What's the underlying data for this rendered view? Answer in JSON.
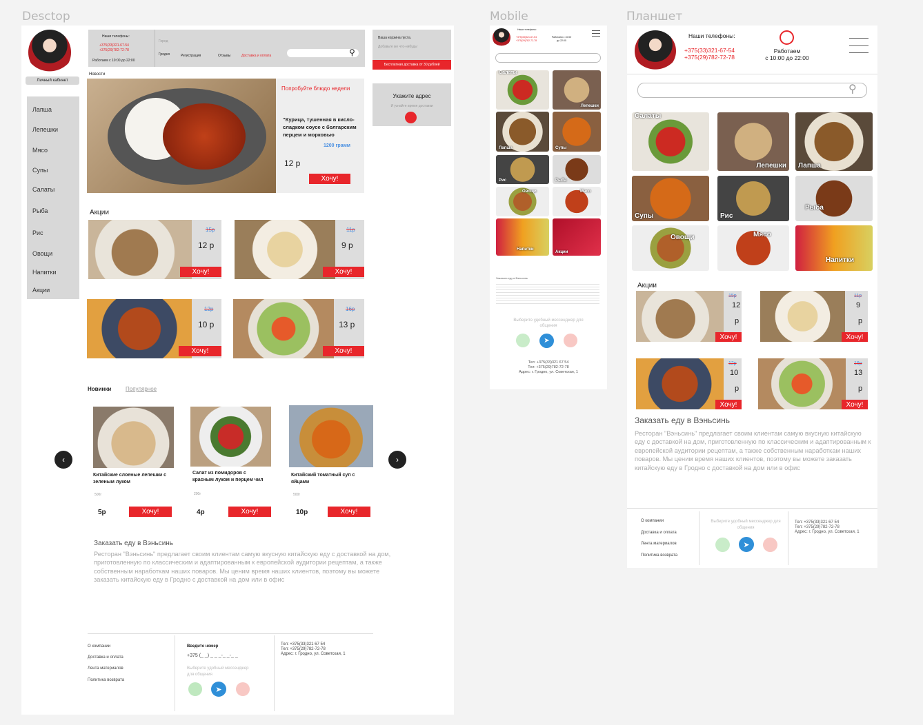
{
  "labels": {
    "desktop": "Desctop",
    "mobile": "Mobile",
    "tablet": "Планшет"
  },
  "desktop": {
    "header": {
      "phones_title": "Наши телефоны:",
      "phone1": "+375(33)321-67-54",
      "phone2": "+375(29)782-72-78",
      "hours": "Работаем с 10:00 до 22:00",
      "city_label": "Город",
      "city": "Гродно",
      "nav": [
        "Регистрация",
        "Отзывы",
        "Доставка и оплата"
      ],
      "cart_title": "Ваша корзина пуста.",
      "cart_sub": "Добавьте же что-нибудь!",
      "free_delivery": "Бесплатная доставка от 30 рублей"
    },
    "account": "Личный кабинет",
    "sidebar": [
      "Лапша",
      "Лепешки",
      "Мясо",
      "Супы",
      "Салаты",
      "Рыба",
      "Рис",
      "Овощи",
      "Напитки",
      "Акции"
    ],
    "news": "Новости",
    "hero": {
      "headline": "Попробуйте блюдо недели",
      "desc": "“Курица, тушенная в кисло-сладком соусе с болгарским перцем и морковью",
      "weight": "1200 грамм",
      "price": "12 р",
      "cta": "Хочу!"
    },
    "address": {
      "title": "Укажите адрес",
      "sub": "И узнайте время доставки"
    },
    "promo_title": "Акции",
    "promos": [
      {
        "old": "15р",
        "price": "12 р",
        "cta": "Хочу!"
      },
      {
        "old": "11р",
        "price": "9 р",
        "cta": "Хочу!"
      },
      {
        "old": "12р",
        "price": "10 р",
        "cta": "Хочу!"
      },
      {
        "old": "16р",
        "price": "13 р",
        "cta": "Хочу!"
      }
    ],
    "tabs": [
      "Новинки",
      "Популярное"
    ],
    "products": [
      {
        "name": "Китайские слоеные лепешки с зеленым луком",
        "weight": "500г",
        "price": "5р",
        "cta": "Хочу!"
      },
      {
        "name": "Салат из помидоров с красным луком и перцем чил",
        "weight": "200г",
        "price": "4р",
        "cta": "Хочу!"
      },
      {
        "name": "Китайский томатный суп с яйцами",
        "weight": "500г",
        "price": "10р",
        "cta": "Хочу!"
      }
    ],
    "about_title": "Заказать еду в Вэньсинь",
    "about_text": "Ресторан \"Вэньсинь\" предлагает своим клиентам самую вкусную китайскую еду с доставкой на дом, приготовленную по классическим и адаптированным к европейской аудитории рецептам, а также собственным наработкам наших поваров. Мы ценим время наших клиентов, поэтому вы можете заказать китайскую еду в Гродно с доставкой на дом или в офис",
    "footer": {
      "links": [
        "О компании",
        "Доставка и оплата",
        "Лента материалов",
        "Политика возврата"
      ],
      "enter_number": "Введите номер",
      "phone_mask": "+375 (_ _) _ _ _-_ _-_ _",
      "messenger": "Выберите удобный мессенджер для общения",
      "tel1": "Тел: +375(33)321 67 54",
      "tel2": "Тел: +375(29)782-72-78",
      "address": "Адрес: г. Гродно, ул. Советская, 1"
    }
  },
  "mobile": {
    "phones_title": "Наши телефоны:",
    "phone1": "+375(33)321-67-54",
    "phone2": "+375(29)782-72-78",
    "hours": "Работаем с 10:00 до 22:00",
    "cats": [
      "Салаты",
      "Лепешки",
      "Лапша",
      "Супы",
      "Рис",
      "Рыба",
      "Овощи",
      "Мясо",
      "Напитки",
      "Акции"
    ],
    "about_title": "Заказать еду в Вэньсинь",
    "messenger": "Выберите удобный мессенджер для общения",
    "tel1": "Тел: +375(33)321 67 54",
    "tel2": "Тел: +375(29)782-72-78",
    "address": "Адрес: г. Гродно, ул. Советская, 1"
  },
  "tablet": {
    "phones_title": "Наши телефоны:",
    "phone1": "+375(33)321-67-54",
    "phone2": "+375(29)782-72-78",
    "hours_title": "Работаем",
    "hours": "с 10:00 до 22:00",
    "cats": [
      "Салаты",
      "Лепешки",
      "Лапша",
      "Супы",
      "Рис",
      "Рыба",
      "Овощи",
      "Мясо",
      "Напитки"
    ],
    "promo_title": "Акции",
    "promos": [
      {
        "old": "15р",
        "price": "12",
        "unit": "р",
        "cta": "Хочу!"
      },
      {
        "old": "11р",
        "price": "9",
        "unit": "р",
        "cta": "Хочу!"
      },
      {
        "old": "12р",
        "price": "10",
        "unit": "р",
        "cta": "Хочу!"
      },
      {
        "old": "16р",
        "price": "13",
        "unit": "р",
        "cta": "Хочу!"
      }
    ],
    "about_title": "Заказать еду в Вэньсинь",
    "about_text": "Ресторан \"Вэньсинь\" предлагает своим клиентам самую вкусную китайскую еду с доставкой на дом, приготовленную по классическим и адаптированным к европейской аудитории рецептам, а также собственным наработкам наших поваров. Мы ценим время наших клиентов, поэтому вы можете заказать китайскую еду в Гродно с доставкой на дом или в офис",
    "footer": {
      "links": [
        "О компании",
        "Доставка и оплата",
        "Лента материалов",
        "Политика возврата"
      ],
      "messenger": "Выберите удобный мессенджер для общения",
      "tel1": "Тел: +375(33)321 67 54",
      "tel2": "Тел: +375(29)782-72-78",
      "address": "Адрес: г. Гродно, ул. Советская, 1"
    }
  },
  "colors": {
    "accent": "#e8262b",
    "sidebar": "#d8d8d8",
    "link_blue": "#4a90e2"
  }
}
